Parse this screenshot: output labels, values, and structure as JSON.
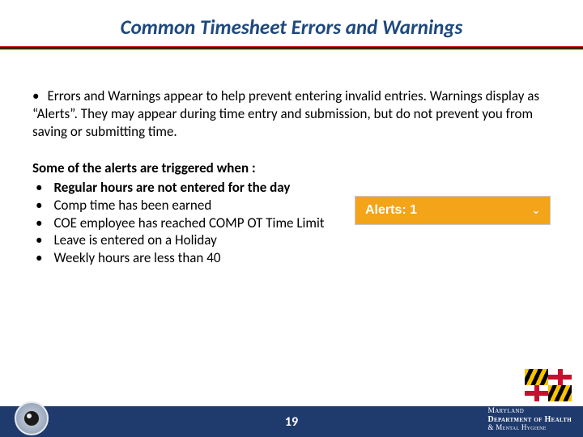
{
  "title": "Common Timesheet Errors and Warnings",
  "paragraph": {
    "lead_bullet": "Errors and Warnings appear to help prevent entering invalid entries.",
    "rest": "Warnings  display as “Alerts”.  They may appear during time entry and submission, but do not prevent you from saving or submitting time."
  },
  "alerts_intro": "Some of the alerts are triggered when :",
  "alerts": [
    "Regular hours are not entered for the day",
    "Comp time has been earned",
    "COE employee has reached COMP OT Time Limit",
    "Leave is entered on a Holiday",
    "Weekly hours are less than 40"
  ],
  "alert_badge": {
    "label": "Alerts: 1"
  },
  "page_number": "19",
  "department": {
    "line1": "Maryland",
    "line2": "Department of Health",
    "line3": "& Mental Hygiene"
  }
}
